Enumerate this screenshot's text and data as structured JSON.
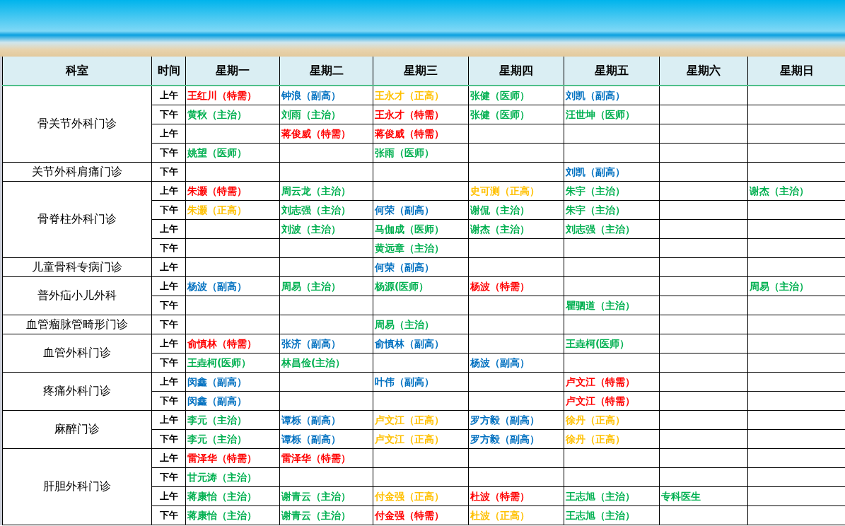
{
  "table": {
    "columns": [
      "科室",
      "时间",
      "星期一",
      "星期二",
      "星期三",
      "星期四",
      "星期五",
      "星期六",
      "星期日"
    ],
    "departments": [
      {
        "name": "骨关节外科门诊",
        "slots": [
          {
            "time": "上午",
            "cells": [
              {
                "text": "王红川（特需）",
                "color": "#ff0000"
              },
              {
                "text": "钟浪（副高）",
                "color": "#0070c0"
              },
              {
                "text": "王永才（正高）",
                "color": "#ffc000"
              },
              {
                "text": "张健（医师）",
                "color": "#00b050"
              },
              {
                "text": "刘凯（副高）",
                "color": "#0070c0"
              }
            ]
          },
          {
            "time": "下午",
            "cells": [
              {
                "text": "黄秋（主治）",
                "color": "#00b050"
              },
              {
                "text": "刘雨（主治）",
                "color": "#00b050"
              },
              {
                "text": "王永才（特需）",
                "color": "#ff0000"
              },
              {
                "text": "张健（医师）",
                "color": "#00b050"
              },
              {
                "text": "汪世坤（医师）",
                "color": "#00b050"
              }
            ]
          },
          {
            "time": "上午",
            "cells": [
              null,
              {
                "text": "蒋俊威（特需）",
                "color": "#ff0000"
              },
              {
                "text": "蒋俊威（特需）",
                "color": "#ff0000"
              }
            ]
          },
          {
            "time": "下午",
            "cells": [
              {
                "text": "姚望（医师）",
                "color": "#00b050"
              },
              null,
              {
                "text": "张雨（医师）",
                "color": "#00b050"
              }
            ]
          }
        ]
      },
      {
        "name": "关节外科肩痛门诊",
        "slots": [
          {
            "time": "下午",
            "cells": [
              null,
              null,
              null,
              null,
              {
                "text": "刘凯（副高）",
                "color": "#0070c0"
              }
            ]
          }
        ]
      },
      {
        "name": "骨脊柱外科门诊",
        "slots": [
          {
            "time": "上午",
            "cells": [
              {
                "text": "朱灏（特需）",
                "color": "#ff0000"
              },
              {
                "text": "周云龙（主治）",
                "color": "#00b050"
              },
              null,
              {
                "text": "史可测（正高）",
                "color": "#ffc000"
              },
              {
                "text": "朱宇（主治）",
                "color": "#00b050"
              },
              null,
              {
                "text": "谢杰（主治）",
                "color": "#00b050"
              }
            ]
          },
          {
            "time": "下午",
            "cells": [
              {
                "text": "朱灏（正高）",
                "color": "#ffc000"
              },
              {
                "text": "刘志强（主治）",
                "color": "#00b050"
              },
              {
                "text": "何荣（副高）",
                "color": "#0070c0"
              },
              {
                "text": "谢侃（主治）",
                "color": "#00b050"
              },
              {
                "text": "朱宇（主治）",
                "color": "#00b050"
              }
            ]
          },
          {
            "time": "上午",
            "cells": [
              null,
              {
                "text": "刘波（主治）",
                "color": "#00b050"
              },
              {
                "text": "马伽成（医师）",
                "color": "#00b050"
              },
              {
                "text": "谢杰（主治）",
                "color": "#00b050"
              },
              {
                "text": "刘志强（主治）",
                "color": "#00b050"
              }
            ]
          },
          {
            "time": "下午",
            "cells": [
              null,
              null,
              {
                "text": "黄远章（主治）",
                "color": "#00b050"
              }
            ]
          }
        ]
      },
      {
        "name": "儿童骨科专病门诊",
        "slots": [
          {
            "time": "上午",
            "cells": [
              null,
              null,
              {
                "text": "何荣（副高）",
                "color": "#0070c0"
              }
            ]
          }
        ]
      },
      {
        "name": "普外疝小儿外科",
        "slots": [
          {
            "time": "上午",
            "cells": [
              {
                "text": "杨波（副高）",
                "color": "#0070c0"
              },
              {
                "text": "周易（主治）",
                "color": "#00b050"
              },
              {
                "text": "杨源(医师）",
                "color": "#00b050"
              },
              {
                "text": "杨波（特需）",
                "color": "#ff0000"
              },
              null,
              null,
              {
                "text": "周易（主治）",
                "color": "#00b050"
              }
            ]
          },
          {
            "time": "下午",
            "cells": [
              null,
              null,
              null,
              null,
              {
                "text": "瞿驷道（主治）",
                "color": "#00b050"
              }
            ]
          }
        ]
      },
      {
        "name": "血管瘤脉管畸形门诊",
        "slots": [
          {
            "time": "下午",
            "cells": [
              null,
              null,
              {
                "text": "周易（主治）",
                "color": "#00b050"
              }
            ]
          }
        ]
      },
      {
        "name": "血管外科门诊",
        "slots": [
          {
            "time": "上午",
            "cells": [
              {
                "text": "俞慎林（特需）",
                "color": "#ff0000"
              },
              {
                "text": "张济（副高）",
                "color": "#0070c0"
              },
              {
                "text": "俞慎林（副高）",
                "color": "#0070c0"
              },
              null,
              {
                "text": "王垚柯(医师）",
                "color": "#00b050"
              }
            ]
          },
          {
            "time": "下午",
            "cells": [
              {
                "text": "王垚柯(医师）",
                "color": "#00b050"
              },
              {
                "text": "林昌俭(主治）",
                "color": "#00b050"
              },
              null,
              {
                "text": "杨波（副高）",
                "color": "#0070c0"
              }
            ]
          }
        ]
      },
      {
        "name": "疼痛外科门诊",
        "slots": [
          {
            "time": "上午",
            "cells": [
              {
                "text": "闵鑫（副高）",
                "color": "#0070c0"
              },
              null,
              {
                "text": "叶伟（副高）",
                "color": "#0070c0"
              },
              null,
              {
                "text": "卢文江（特需）",
                "color": "#ff0000"
              }
            ]
          },
          {
            "time": "下午",
            "cells": [
              {
                "text": "闵鑫（副高）",
                "color": "#0070c0"
              },
              null,
              null,
              null,
              {
                "text": "卢文江（特需）",
                "color": "#ff0000"
              }
            ]
          }
        ]
      },
      {
        "name": "麻醉门诊",
        "slots": [
          {
            "time": "上午",
            "cells": [
              {
                "text": "李元（主治）",
                "color": "#00b050"
              },
              {
                "text": "谭栎（副高）",
                "color": "#0070c0"
              },
              {
                "text": "卢文江（正高）",
                "color": "#ffc000"
              },
              {
                "text": "罗方毅（副高）",
                "color": "#0070c0"
              },
              {
                "text": "徐丹（正高）",
                "color": "#ffc000"
              }
            ]
          },
          {
            "time": "下午",
            "cells": [
              {
                "text": "李元（主治）",
                "color": "#00b050"
              },
              {
                "text": "谭栎（副高）",
                "color": "#0070c0"
              },
              {
                "text": "卢文江（正高）",
                "color": "#ffc000"
              },
              {
                "text": "罗方毅（副高）",
                "color": "#0070c0"
              },
              {
                "text": "徐丹（正高）",
                "color": "#ffc000"
              }
            ]
          }
        ]
      },
      {
        "name": "肝胆外科门诊",
        "slots": [
          {
            "time": "上午",
            "cells": [
              {
                "text": "雷泽华（特需）",
                "color": "#ff0000"
              },
              {
                "text": "雷泽华（特需）",
                "color": "#ff0000"
              }
            ]
          },
          {
            "time": "下午",
            "cells": [
              {
                "text": "甘元涛（主治）",
                "color": "#00b050"
              }
            ]
          },
          {
            "time": "上午",
            "cells": [
              {
                "text": "蒋康怡（主治）",
                "color": "#00b050"
              },
              {
                "text": "谢青云（主治）",
                "color": "#00b050"
              },
              {
                "text": "付金强（正高）",
                "color": "#ffc000"
              },
              {
                "text": "杜波（特需）",
                "color": "#ff0000"
              },
              {
                "text": "王志旭（主治）",
                "color": "#00b050"
              },
              {
                "text": "专科医生",
                "color": "#00b050"
              }
            ]
          },
          {
            "time": "下午",
            "cells": [
              {
                "text": "蒋康怡（主治）",
                "color": "#00b050"
              },
              {
                "text": "谢青云（主治）",
                "color": "#00b050"
              },
              {
                "text": "付金强（特需）",
                "color": "#ff0000"
              },
              {
                "text": "杜波（正高）",
                "color": "#ffc000"
              },
              {
                "text": "王志旭（主治）",
                "color": "#00b050"
              }
            ]
          }
        ]
      }
    ]
  }
}
